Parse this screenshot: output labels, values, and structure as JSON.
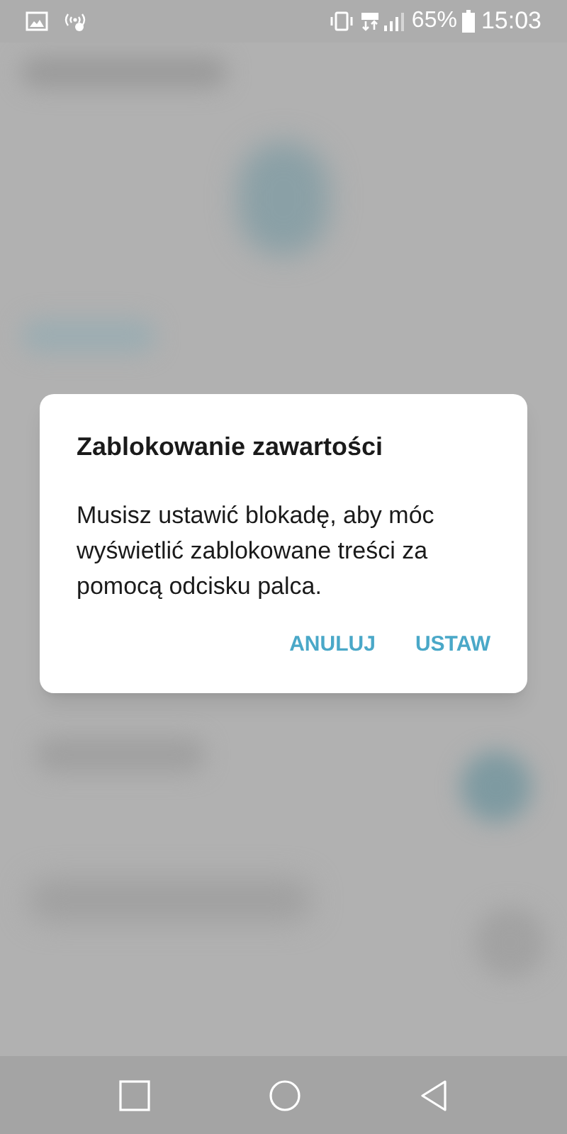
{
  "status_bar": {
    "battery_percent": "65%",
    "time": "15:03"
  },
  "dialog": {
    "title": "Zablokowanie zawartości",
    "message": "Musisz ustawić blokadę, aby móc wyświetlić zablokowane treści za pomocą odcisku palca.",
    "buttons": [
      "ANULUJ",
      "USTAW"
    ]
  }
}
